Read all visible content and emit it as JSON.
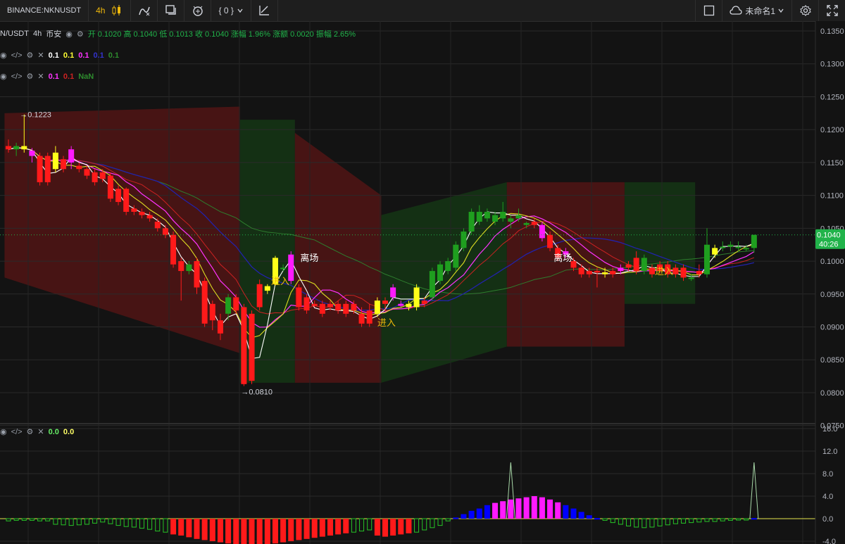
{
  "toolbar": {
    "symbol": "BINANCE:NKNUSDT",
    "interval": "4h",
    "indicators_label": "{ 0 }",
    "layout_name": "未命名1"
  },
  "header": {
    "pair": "N/USDT",
    "interval": "4h",
    "exchange": "币安",
    "ohlc": [
      {
        "label": "开",
        "value": "0.1020"
      },
      {
        "label": "高",
        "value": "0.1040"
      },
      {
        "label": "低",
        "value": "0.1013"
      },
      {
        "label": "收",
        "value": "0.1040"
      },
      {
        "label": "涨幅",
        "value": "1.96%"
      },
      {
        "label": "涨额",
        "value": "0.0020"
      },
      {
        "label": "振幅",
        "value": "2.65%"
      }
    ]
  },
  "legend_rows": [
    {
      "values": [
        {
          "text": "0.1",
          "color": "#ffffff"
        },
        {
          "text": "0.1",
          "color": "#ffff33"
        },
        {
          "text": "0.1",
          "color": "#ff33ff"
        },
        {
          "text": "0.1",
          "color": "#3333cc"
        },
        {
          "text": "0.1",
          "color": "#2e8b2e"
        }
      ]
    },
    {
      "values": [
        {
          "text": "0.1",
          "color": "#ff33ff"
        },
        {
          "text": "0.1",
          "color": "#cc2222"
        },
        {
          "text": "NaN",
          "color": "#2e8b2e"
        }
      ]
    }
  ],
  "osc_legend": {
    "values": [
      {
        "text": "0.0",
        "color": "#66ee66"
      },
      {
        "text": "0.0",
        "color": "#ffff66"
      }
    ]
  },
  "colors": {
    "up": "#1f9e1f",
    "down": "#ff1a1a",
    "cloud_red": "#4a1414",
    "cloud_green": "#143214",
    "yellow": "#ffff1a",
    "magenta": "#ff1aff",
    "blue": "#0000ff"
  },
  "price_axis": {
    "ticks": [
      "0.1350",
      "0.1300",
      "0.1250",
      "0.1200",
      "0.1150",
      "0.1100",
      "0.1050",
      "0.1000",
      "0.0950",
      "0.0900",
      "0.0850",
      "0.0800",
      "0.0750"
    ],
    "current_price": "0.1040",
    "countdown": "40:26"
  },
  "osc_axis": {
    "ticks": [
      "16.0",
      "12.0",
      "8.0",
      "4.0",
      "0.0",
      "-4.0"
    ]
  },
  "annotations": [
    {
      "text": "→0.1223",
      "type": "high"
    },
    {
      "text": "→0.0810",
      "type": "low"
    },
    {
      "text": "离场",
      "type": "label"
    },
    {
      "text": "进入",
      "type": "label"
    },
    {
      "text": "进入",
      "type": "label"
    },
    {
      "text": "离场",
      "type": "label"
    },
    {
      "text": "进入",
      "type": "label"
    }
  ],
  "chart_data": {
    "type": "candlestick",
    "ylim": [
      0.0755,
      0.1365
    ],
    "candles": [
      [
        0.1175,
        0.1185,
        0.1165,
        0.117
      ],
      [
        0.117,
        0.118,
        0.116,
        0.1175
      ],
      [
        0.1175,
        0.1223,
        0.1165,
        0.117
      ],
      [
        0.1168,
        0.1172,
        0.115,
        0.116
      ],
      [
        0.116,
        0.1165,
        0.1115,
        0.112
      ],
      [
        0.116,
        0.1165,
        0.1115,
        0.112
      ],
      [
        0.114,
        0.1175,
        0.1135,
        0.1165
      ],
      [
        0.1155,
        0.116,
        0.1135,
        0.114
      ],
      [
        0.115,
        0.1175,
        0.114,
        0.117
      ],
      [
        0.1145,
        0.115,
        0.1135,
        0.114
      ],
      [
        0.114,
        0.1145,
        0.1125,
        0.113
      ],
      [
        0.1135,
        0.114,
        0.1115,
        0.112
      ],
      [
        0.1135,
        0.114,
        0.112,
        0.1125
      ],
      [
        0.113,
        0.1135,
        0.109,
        0.1095
      ],
      [
        0.111,
        0.1115,
        0.1085,
        0.109
      ],
      [
        0.111,
        0.1112,
        0.107,
        0.1075
      ],
      [
        0.108,
        0.1085,
        0.107,
        0.1075
      ],
      [
        0.1075,
        0.108,
        0.1065,
        0.107
      ],
      [
        0.107,
        0.1075,
        0.106,
        0.1065
      ],
      [
        0.106,
        0.1065,
        0.1045,
        0.105
      ],
      [
        0.105,
        0.1055,
        0.1035,
        0.104
      ],
      [
        0.104,
        0.1045,
        0.099,
        0.0995
      ],
      [
        0.1,
        0.1005,
        0.094,
        0.0985
      ],
      [
        0.0985,
        0.1,
        0.098,
        0.0995
      ],
      [
        0.1,
        0.1005,
        0.095,
        0.096
      ],
      [
        0.097,
        0.0975,
        0.09,
        0.0905
      ],
      [
        0.0935,
        0.094,
        0.0895,
        0.091
      ],
      [
        0.091,
        0.092,
        0.088,
        0.089
      ],
      [
        0.092,
        0.095,
        0.091,
        0.0945
      ],
      [
        0.0945,
        0.095,
        0.092,
        0.0925
      ],
      [
        0.093,
        0.0935,
        0.081,
        0.0813
      ],
      [
        0.092,
        0.0925,
        0.0813,
        0.0818
      ],
      [
        0.0965,
        0.0972,
        0.0925,
        0.093
      ],
      [
        0.0955,
        0.0965,
        0.095,
        0.0962
      ],
      [
        0.0965,
        0.1008,
        0.0963,
        0.1005
      ],
      [
        0.099,
        0.0995,
        0.0985,
        0.099
      ],
      [
        0.097,
        0.1015,
        0.0965,
        0.101
      ],
      [
        0.096,
        0.0965,
        0.0925,
        0.093
      ],
      [
        0.0945,
        0.095,
        0.092,
        0.0925
      ],
      [
        0.0935,
        0.094,
        0.093,
        0.0932
      ],
      [
        0.0935,
        0.094,
        0.0915,
        0.092
      ],
      [
        0.0935,
        0.094,
        0.0925,
        0.093
      ],
      [
        0.0935,
        0.094,
        0.092,
        0.0925
      ],
      [
        0.0935,
        0.094,
        0.0915,
        0.092
      ],
      [
        0.0935,
        0.094,
        0.092,
        0.0925
      ],
      [
        0.092,
        0.093,
        0.09,
        0.0905
      ],
      [
        0.0925,
        0.0935,
        0.09,
        0.0905
      ],
      [
        0.092,
        0.0945,
        0.0915,
        0.094
      ],
      [
        0.094,
        0.0945,
        0.0925,
        0.0935
      ],
      [
        0.0945,
        0.0965,
        0.094,
        0.096
      ],
      [
        0.0935,
        0.094,
        0.093,
        0.0932
      ],
      [
        0.093,
        0.094,
        0.0925,
        0.0935
      ],
      [
        0.093,
        0.0965,
        0.0925,
        0.096
      ],
      [
        0.094,
        0.0945,
        0.093,
        0.0935
      ],
      [
        0.0945,
        0.099,
        0.094,
        0.0985
      ],
      [
        0.097,
        0.1,
        0.0965,
        0.0995
      ],
      [
        0.0985,
        0.1005,
        0.098,
        0.1
      ],
      [
        0.099,
        0.103,
        0.0985,
        0.1025
      ],
      [
        0.102,
        0.105,
        0.1015,
        0.1045
      ],
      [
        0.1045,
        0.108,
        0.104,
        0.1075
      ],
      [
        0.106,
        0.1085,
        0.1055,
        0.1075
      ],
      [
        0.1065,
        0.108,
        0.106,
        0.1075
      ],
      [
        0.106,
        0.1075,
        0.1055,
        0.107
      ],
      [
        0.1065,
        0.109,
        0.106,
        0.1075
      ],
      [
        0.106,
        0.107,
        0.105,
        0.1065
      ],
      [
        0.1065,
        0.108,
        0.106,
        0.107
      ],
      [
        0.1055,
        0.106,
        0.105,
        0.1058
      ],
      [
        0.106,
        0.1065,
        0.105,
        0.1055
      ],
      [
        0.1055,
        0.106,
        0.103,
        0.1035
      ],
      [
        0.104,
        0.1045,
        0.1015,
        0.102
      ],
      [
        0.102,
        0.1025,
        0.1,
        0.1005
      ],
      [
        0.1015,
        0.102,
        0.1005,
        0.101
      ],
      [
        0.1,
        0.1005,
        0.0985,
        0.099
      ],
      [
        0.099,
        0.0995,
        0.0975,
        0.098
      ],
      [
        0.0985,
        0.099,
        0.0975,
        0.098
      ],
      [
        0.0985,
        0.099,
        0.096,
        0.0983
      ],
      [
        0.0983,
        0.099,
        0.0975,
        0.098
      ],
      [
        0.0985,
        0.099,
        0.0975,
        0.098
      ],
      [
        0.099,
        0.0995,
        0.098,
        0.0985
      ],
      [
        0.0995,
        0.1,
        0.0985,
        0.099
      ],
      [
        0.1005,
        0.1015,
        0.098,
        0.0985
      ],
      [
        0.0985,
        0.101,
        0.098,
        0.1005
      ],
      [
        0.099,
        0.0995,
        0.0975,
        0.098
      ],
      [
        0.0995,
        0.1,
        0.098,
        0.0985
      ],
      [
        0.0995,
        0.1,
        0.0975,
        0.098
      ],
      [
        0.099,
        0.0995,
        0.0975,
        0.098
      ],
      [
        0.099,
        0.0995,
        0.097,
        0.0975
      ],
      [
        0.0975,
        0.098,
        0.097,
        0.0975
      ],
      [
        0.0985,
        0.0995,
        0.0975,
        0.098
      ],
      [
        0.098,
        0.105,
        0.0975,
        0.1025
      ],
      [
        0.101,
        0.1025,
        0.1005,
        0.102
      ],
      [
        0.102,
        0.103,
        0.1015,
        0.1022
      ],
      [
        0.1022,
        0.103,
        0.1015,
        0.1025
      ],
      [
        0.102,
        0.103,
        0.1015,
        0.1022
      ],
      [
        0.102,
        0.1025,
        0.1015,
        0.102
      ],
      [
        0.102,
        0.104,
        0.1013,
        0.104
      ]
    ],
    "highlight_candles": [
      {
        "index": 2,
        "color": "yellow"
      },
      {
        "index": 3,
        "color": "magenta"
      },
      {
        "index": 6,
        "color": "yellow"
      },
      {
        "index": 8,
        "color": "magenta"
      },
      {
        "index": 34,
        "color": "yellow"
      },
      {
        "index": 33,
        "color": "yellow"
      },
      {
        "index": 36,
        "color": "magenta"
      },
      {
        "index": 47,
        "color": "yellow"
      },
      {
        "index": 49,
        "color": "magenta"
      },
      {
        "index": 51,
        "color": "yellow"
      },
      {
        "index": 50,
        "color": "magenta"
      },
      {
        "index": 52,
        "color": "yellow"
      },
      {
        "index": 68,
        "color": "magenta"
      },
      {
        "index": 71,
        "color": "magenta"
      },
      {
        "index": 76,
        "color": "yellow"
      },
      {
        "index": 78,
        "color": "magenta"
      },
      {
        "index": 90,
        "color": "yellow"
      }
    ],
    "oscillator": {
      "ylim": [
        -4.5,
        16.5
      ],
      "histogram": [
        -0.4,
        -0.3,
        -0.3,
        -0.3,
        -0.4,
        -0.4,
        -1.0,
        -1.1,
        -1.2,
        -1.1,
        -1.0,
        -0.8,
        -0.6,
        -0.9,
        -1.2,
        -1.4,
        -1.5,
        -1.7,
        -1.9,
        -2.2,
        -2.4,
        -2.8,
        -3.0,
        -3.3,
        -3.6,
        -3.8,
        -4.0,
        -4.2,
        -4.4,
        -4.6,
        -4.8,
        -4.9,
        -4.6,
        -4.6,
        -4.4,
        -4.2,
        -4.0,
        -3.8,
        -3.6,
        -3.4,
        -3.2,
        -3.0,
        -2.8,
        -2.6,
        -2.4,
        -2.2,
        -2.0,
        -3.0,
        -3.2,
        -3.0,
        -2.8,
        -2.6,
        -2.4,
        -2.0,
        -1.6,
        -1.2,
        -0.4,
        0.2,
        0.8,
        1.4,
        1.8,
        2.4,
        2.8,
        3.1,
        3.4,
        3.6,
        3.8,
        4.0,
        3.8,
        3.4,
        2.9,
        2.4,
        1.8,
        1.2,
        0.6,
        0.1,
        -0.3,
        -0.7,
        -1.0,
        -1.3,
        -1.5,
        -1.6,
        -1.5,
        -1.3,
        -1.1,
        -0.9,
        -0.8,
        -0.7,
        -0.6,
        -0.5,
        -0.5,
        -0.4,
        -0.3,
        -0.2,
        -0.1,
        0.1
      ]
    }
  }
}
